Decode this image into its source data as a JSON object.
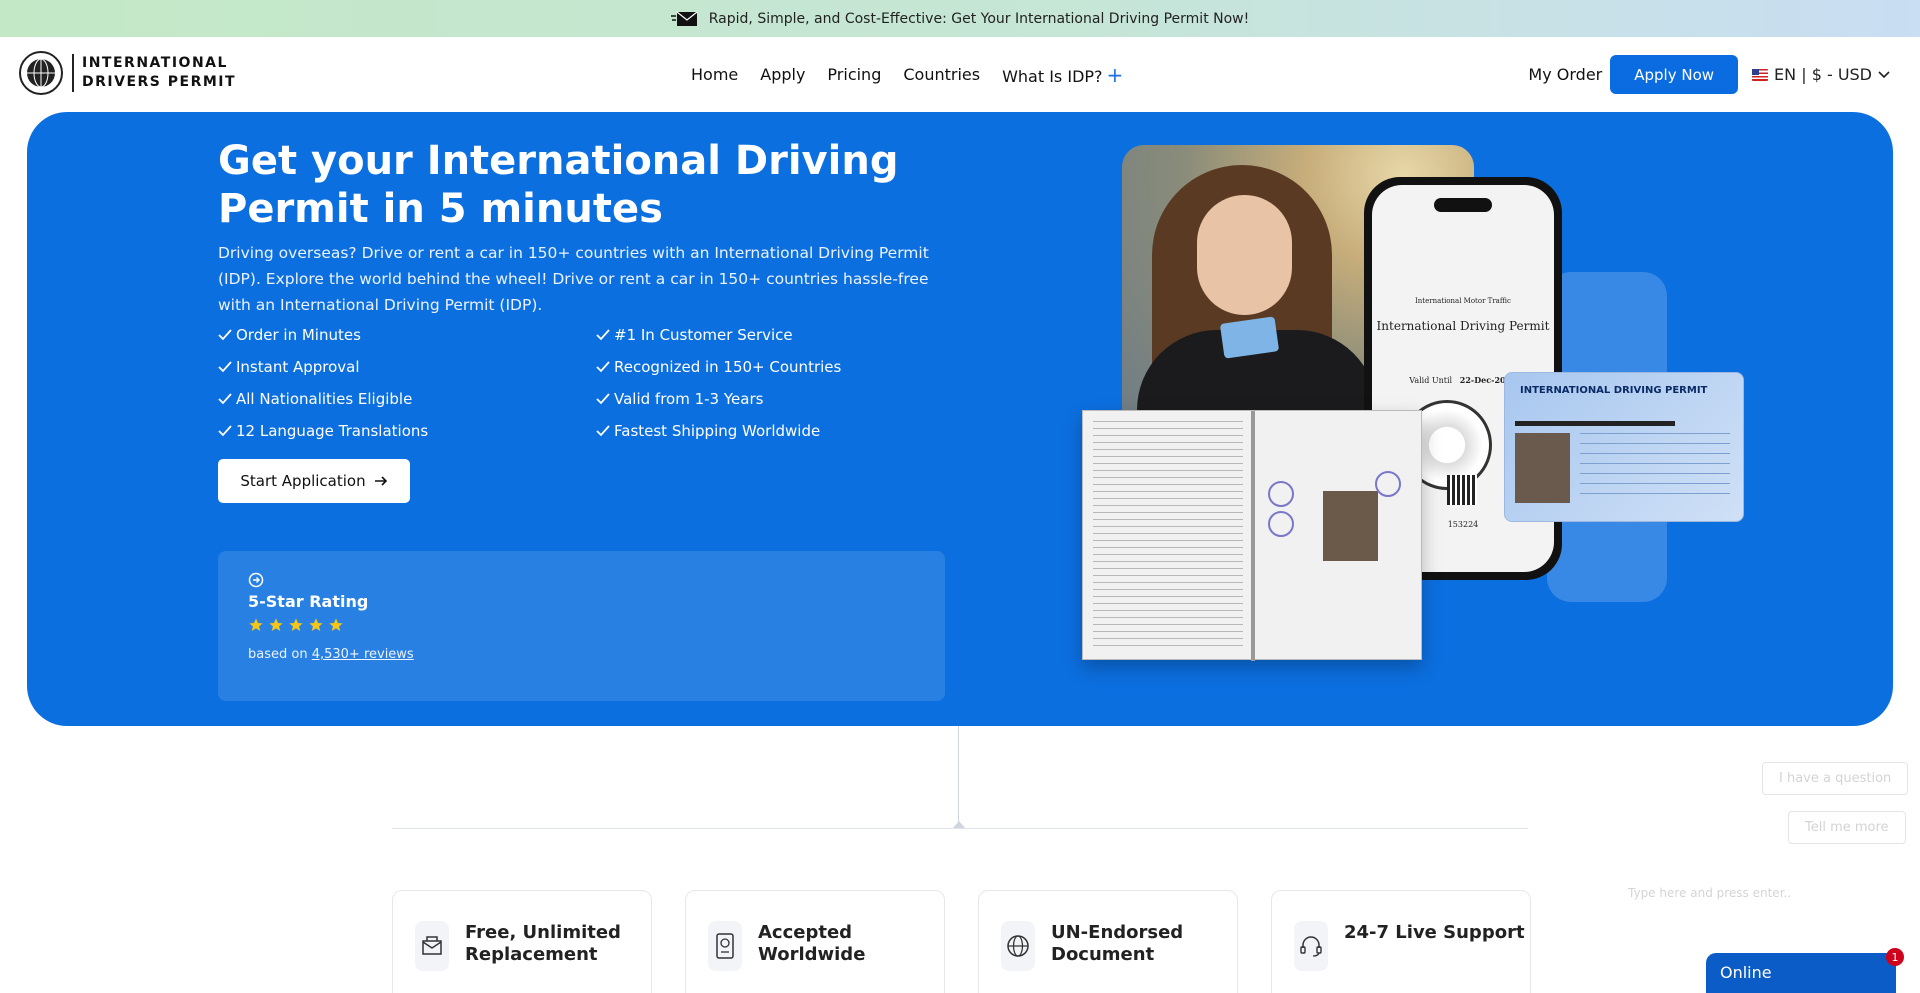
{
  "promo": {
    "text": "Rapid, Simple, and Cost-Effective: Get Your International Driving Permit Now!"
  },
  "logo": {
    "line1": "INTERNATIONAL",
    "line2": "DRIVERS PERMIT"
  },
  "nav": {
    "items": [
      "Home",
      "Apply",
      "Pricing",
      "Countries",
      "What Is IDP?"
    ],
    "plus": "+"
  },
  "header": {
    "my_order": "My Order",
    "apply_now": "Apply Now",
    "lang": "EN | $ - USD"
  },
  "hero": {
    "title": "Get your International Driving Permit in 5 minutes",
    "description": "Driving overseas? Drive or rent a car in 150+ countries with an International Driving Permit (IDP). Explore the world behind the wheel! Drive or rent a car in 150+ countries hassle-free with an International Driving Permit (IDP).",
    "features": [
      "Order in Minutes",
      "#1 In Customer Service",
      "Instant Approval",
      "Recognized in 150+ Countries",
      "All Nationalities Eligible",
      "Valid from 1-3 Years",
      "12 Language Translations",
      "Fastest Shipping Worldwide"
    ],
    "cta": "Start Application",
    "rating": {
      "title": "5-Star Rating",
      "stars": 5,
      "based_prefix": "based on ",
      "reviews_link": "4,530+ reviews"
    }
  },
  "art": {
    "phone_line1": "International Motor Traffic",
    "phone_title": "International Driving Permit",
    "phone_valid": "Valid Until",
    "phone_date": "22-Dec-2026",
    "phone_number": "153224",
    "idcard_title": "INTERNATIONAL DRIVING PERMIT"
  },
  "chat": {
    "q1": "I have a question",
    "q2": "Tell me more",
    "placeholder": "Type here and press enter.."
  },
  "cards": [
    {
      "icon": "envelope-icon",
      "title": "Free, Unlimited Replacement"
    },
    {
      "icon": "passport-icon",
      "title": "Accepted Worldwide"
    },
    {
      "icon": "globe-icon",
      "title": "UN-Endorsed Document"
    },
    {
      "icon": "headset-icon",
      "title": "24-7 Live Support"
    }
  ],
  "online_widget": {
    "label": "Online",
    "badge": "1"
  },
  "colors": {
    "primary": "#0c6fe0",
    "button": "#0b6be0",
    "star": "#f5c518"
  }
}
